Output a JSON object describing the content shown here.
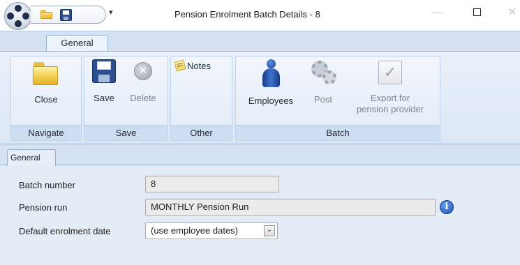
{
  "window": {
    "title": "Pension Enrolment Batch Details - 8",
    "qat_dropdown_glyph": "▾",
    "minimize_glyph": "—",
    "close_glyph": "✕"
  },
  "ribbon": {
    "tab": "General",
    "groups": [
      {
        "label": "Navigate",
        "buttons": [
          {
            "label": "Close",
            "icon": "folder-icon",
            "enabled": true
          }
        ]
      },
      {
        "label": "Save",
        "buttons": [
          {
            "label": "Save",
            "icon": "save-disk-icon",
            "enabled": true
          },
          {
            "label": "Delete",
            "icon": "delete-icon",
            "enabled": false
          }
        ]
      },
      {
        "label": "Other",
        "buttons": [
          {
            "label": "Notes",
            "icon": "notes-icon",
            "enabled": true
          }
        ]
      },
      {
        "label": "Batch",
        "buttons": [
          {
            "label": "Employees",
            "icon": "person-icon",
            "enabled": true
          },
          {
            "label": "Post",
            "icon": "gears-icon",
            "enabled": false
          },
          {
            "label_line1": "Export for",
            "label_line2": "pension provider",
            "icon": "export-check-icon",
            "enabled": false
          }
        ]
      }
    ]
  },
  "content": {
    "tab": "General",
    "fields": {
      "batch_number": {
        "label": "Batch number",
        "value": "8"
      },
      "pension_run": {
        "label": "Pension run",
        "value": "MONTHLY Pension Run"
      },
      "default_enrolment_date": {
        "label": "Default enrolment date",
        "value": "(use employee dates)"
      }
    },
    "info_glyph": "i",
    "dropdown_glyph": "⌄"
  },
  "colors": {
    "ribbon_background": "#dce7f5",
    "group_label_background": "#cedef2",
    "content_background": "#e3ebf5",
    "readonly_field": "#ebebeb",
    "info_icon": "#1d4fae"
  }
}
